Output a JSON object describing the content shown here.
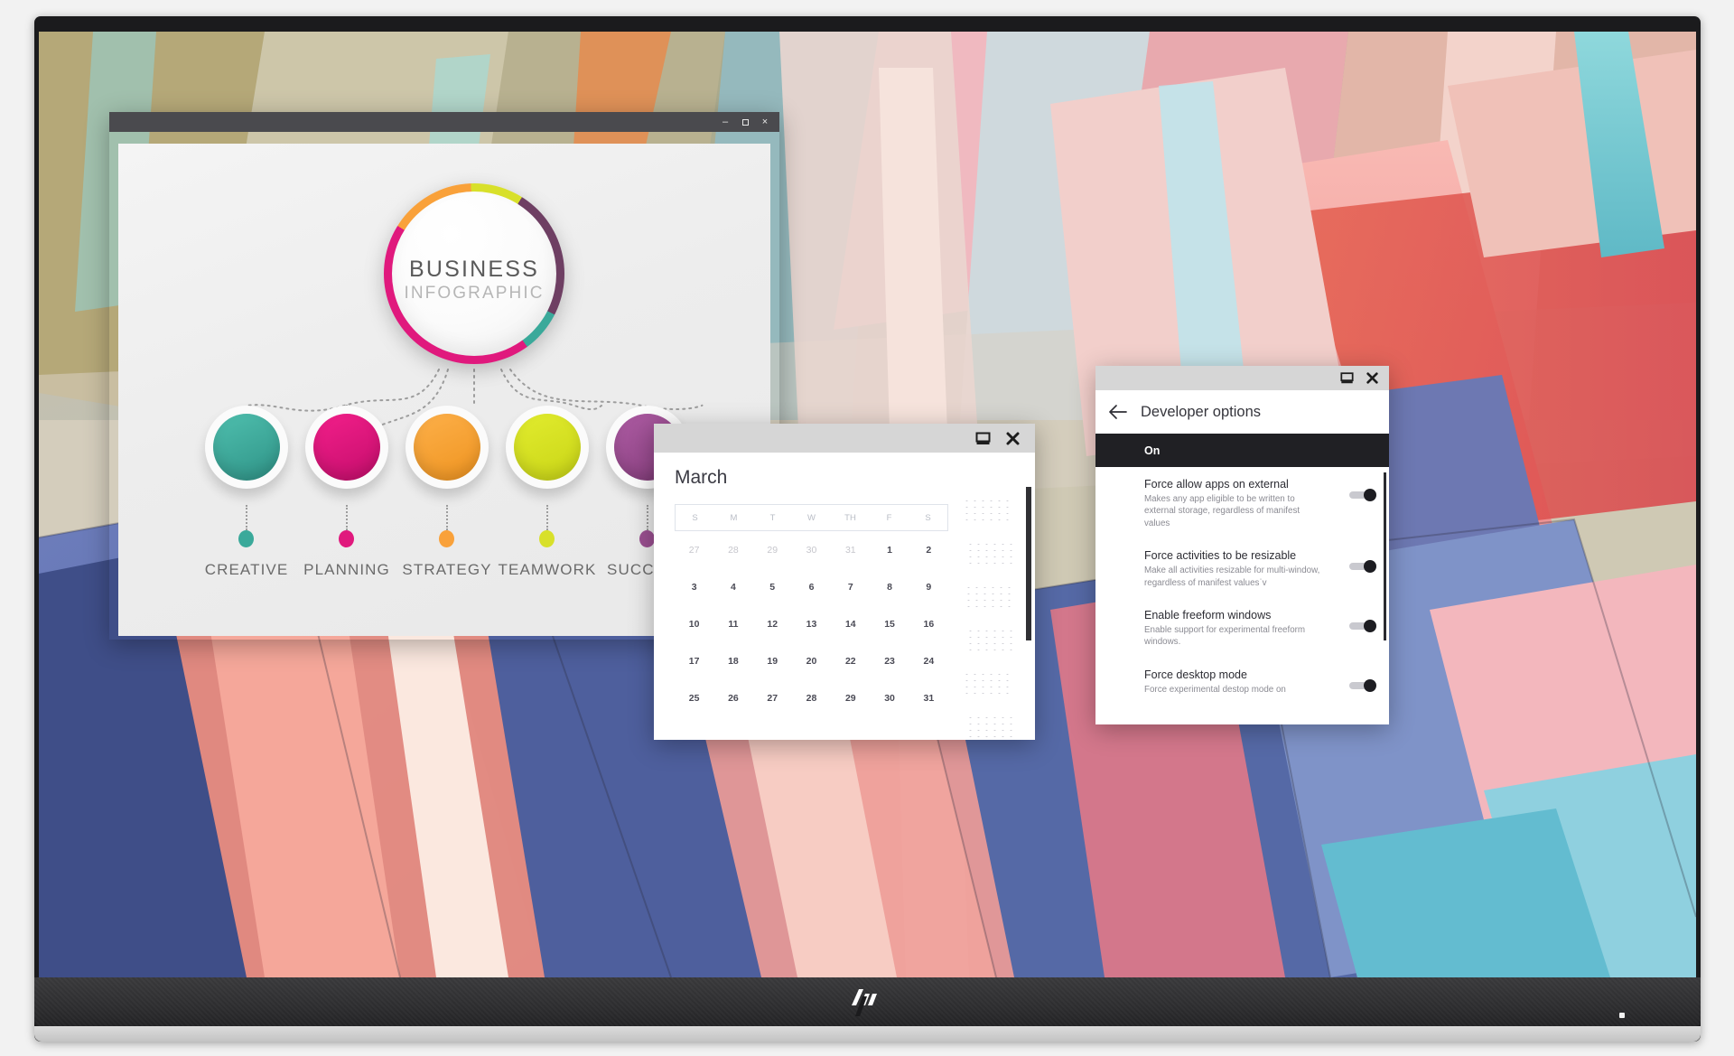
{
  "desktop": {
    "monitor_brand": "hp",
    "wallpaper_name": "abstract-geometric-beams"
  },
  "infographic_window": {
    "titlebar": {
      "minimize_label": "–",
      "maximize_label": "❐",
      "close_label": "×"
    },
    "center": {
      "title": "BUSINESS",
      "subtitle": "INFOGRAPHIC"
    },
    "nodes": [
      {
        "label": "CREATIVE",
        "color": "#3aa99a"
      },
      {
        "label": "PLANNING",
        "color": "#e0197d"
      },
      {
        "label": "STRATEGY",
        "color": "#f9a13a"
      },
      {
        "label": "TEAMWORK",
        "color": "#d8e02a"
      },
      {
        "label": "SUCCESS",
        "color": "#9a4f90"
      }
    ],
    "ring_colors": [
      "#e0197d",
      "#f9a13a",
      "#d8e02a",
      "#6e3f63",
      "#3aa99a"
    ]
  },
  "calendar_window": {
    "titlebar": {
      "restore_label": "restore-icon",
      "close_label": "×"
    },
    "month": "March",
    "day_headers": [
      "S",
      "M",
      "T",
      "W",
      "TH",
      "F",
      "S"
    ],
    "weeks": [
      [
        {
          "d": "27",
          "muted": true
        },
        {
          "d": "28",
          "muted": true
        },
        {
          "d": "29",
          "muted": true
        },
        {
          "d": "30",
          "muted": true
        },
        {
          "d": "31",
          "muted": true
        },
        {
          "d": "1",
          "muted": false
        },
        {
          "d": "2",
          "muted": false
        }
      ],
      [
        {
          "d": "3",
          "muted": false
        },
        {
          "d": "4",
          "muted": false
        },
        {
          "d": "5",
          "muted": false
        },
        {
          "d": "6",
          "muted": false
        },
        {
          "d": "7",
          "muted": false
        },
        {
          "d": "8",
          "muted": false
        },
        {
          "d": "9",
          "muted": false
        }
      ],
      [
        {
          "d": "10",
          "muted": false
        },
        {
          "d": "11",
          "muted": false
        },
        {
          "d": "12",
          "muted": false
        },
        {
          "d": "13",
          "muted": false
        },
        {
          "d": "14",
          "muted": false
        },
        {
          "d": "15",
          "muted": false
        },
        {
          "d": "16",
          "muted": false
        }
      ],
      [
        {
          "d": "17",
          "muted": false
        },
        {
          "d": "18",
          "muted": false
        },
        {
          "d": "19",
          "muted": false
        },
        {
          "d": "20",
          "muted": false
        },
        {
          "d": "22",
          "muted": false
        },
        {
          "d": "23",
          "muted": false
        },
        {
          "d": "24",
          "muted": false
        }
      ],
      [
        {
          "d": "25",
          "muted": false
        },
        {
          "d": "26",
          "muted": false
        },
        {
          "d": "27",
          "muted": false
        },
        {
          "d": "28",
          "muted": false
        },
        {
          "d": "29",
          "muted": false
        },
        {
          "d": "30",
          "muted": false
        },
        {
          "d": "31",
          "muted": false
        }
      ]
    ]
  },
  "developer_window": {
    "titlebar": {
      "restore_label": "restore-icon",
      "close_label": "×"
    },
    "back_label": "←",
    "title": "Developer options",
    "master_toggle_label": "On",
    "settings": [
      {
        "title": "Force allow apps on external",
        "description": "Makes any app eligible to be written to external storage, regardless of manifest values",
        "state": "on"
      },
      {
        "title": "Force activities to be resizable",
        "description": "Make all activities resizable for multi-window, regardless of manifest valuesˈv",
        "state": "on"
      },
      {
        "title": "Enable freeform windows",
        "description": "Enable support for experimental freeform windows.",
        "state": "on"
      },
      {
        "title": "Force desktop mode",
        "description": "Force experimental destop mode on",
        "state": "on"
      }
    ]
  }
}
